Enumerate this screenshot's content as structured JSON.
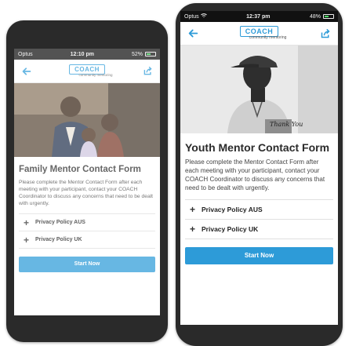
{
  "left_screen": {
    "status": {
      "carrier": "Optus",
      "time": "12:10 pm",
      "battery": "52%"
    },
    "logo": {
      "name": "COACH",
      "tagline": "community mentoring"
    },
    "title": "Family Mentor Contact Form",
    "description": "Please complete the Mentor Contact Form after each meeting with your participant, contact your COACH Coordinator to discuss any concerns that need to be dealt with urgently.",
    "accordion": [
      {
        "label": "Privacy Policy AUS"
      },
      {
        "label": "Privacy Policy UK"
      }
    ],
    "start_button": "Start Now"
  },
  "right_screen": {
    "status": {
      "carrier": "Optus",
      "time": "12:37 pm",
      "battery": "48%"
    },
    "logo": {
      "name": "COACH",
      "tagline": "community mentoring"
    },
    "title": "Youth Mentor Contact Form",
    "description": "Please complete the Mentor Contact Form after each meeting with your participant, contact your COACH Coordinator to discuss any concerns that need to be dealt with urgently.",
    "accordion": [
      {
        "label": "Privacy Policy AUS"
      },
      {
        "label": "Privacy Policy UK"
      }
    ],
    "start_button": "Start Now",
    "shirt_text": "Thank You"
  },
  "icons": {
    "back": "arrow-left-icon",
    "share": "share-icon",
    "plus": "plus-icon",
    "wifi": "wifi-icon",
    "battery": "battery-icon"
  },
  "colors": {
    "accent": "#2d9bd8",
    "phone_body": "#2a2a2a",
    "title_text": "#2b2b2b"
  }
}
